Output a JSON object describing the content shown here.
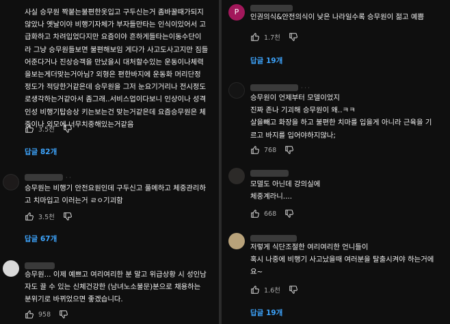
{
  "left": {
    "comments": [
      {
        "lines": [
          "사실 승무원 짝붙는불편한옷입고 구두신는거 좀바꿀때가되지",
          "않았나 옛날이야 비행기자체가 부자들만타는 인식이있어서 고",
          "급화하고 차려입었다지만 요즘이야 흔하게들타는이동수단이",
          "라 그냥 승무원들보면 불편해보임 게다가 사고도사고지만 짐들",
          "어준다거나 진상승객을 만났을시 대처할수있는 운동이나체력",
          "을보는게더맞는거아님? 외형은 편한바지에 운동화 머리단정",
          "정도가 적당한거같은데 승무원을 그저 눈요기거리나 전시정도",
          "로생각하는거같아서 좀그래..서비스업이다보니 인상이나 성격",
          "인성 비행기탑승상 키는보는건 맞는거같은데 요즘승무원은 체",
          "중이나 외모에 너무치중해있는거같음"
        ],
        "likes": "3.5천",
        "replies": "답글 82개"
      },
      {
        "lines": [
          "승무원는 비행기 안전요원인데 구두신고 풀메하고 체중관리하",
          "고 치마입고 이러는거 ㄹㅇ기괴함"
        ],
        "likes": "3.5천",
        "replies": "답글 67개"
      },
      {
        "lines": [
          "승무원... 이제 예쁘고 여리여리한 분 말고 위급상황 시 성인남",
          "자도 끌 수 있는 신체건강한 (남녀노소불문)분으로 채용하는",
          "분위기로 바뀌었으면 좋겠습니다."
        ],
        "likes": "958",
        "replies": ""
      }
    ]
  },
  "right": {
    "comments": [
      {
        "avatar_letter": "P",
        "lines": [
          "인권의식&안전의식이 낮은 나라일수록 승무원이 젊고 예쁨"
        ],
        "likes": "1.7천",
        "replies": "답글 19개"
      },
      {
        "avatar_letter": "",
        "lines": [
          "승무원이 언제부터 모델이었지",
          "진짜 존나 기괴해 승무원이 왜..ㅋㅋ",
          "살을빼고 화장을 하고 불편한 치마를 입을게 아니라 근육을 기",
          "르고 바지를 입어야하지않나;"
        ],
        "likes": "768",
        "replies": ""
      },
      {
        "avatar_letter": "",
        "lines": [
          "모델도 아닌데 강의실에",
          "체중계라니...."
        ],
        "likes": "668",
        "replies": ""
      },
      {
        "avatar_letter": "",
        "lines": [
          "저렇게 식단조절한 여리여리한 언니들이",
          "혹시 나중에 비행기 사고났을때 여러분을 탈출시켜야 하는거에",
          "요~"
        ],
        "likes": "1.6천",
        "replies": "답글 19개"
      }
    ]
  },
  "colors": {
    "background": "#0f0f0f",
    "text": "#f1f1f1",
    "muted": "#aaaaaa",
    "link": "#3ea6ff"
  },
  "icons": {
    "like": "thumbs-up-icon",
    "dislike": "thumbs-down-icon"
  }
}
